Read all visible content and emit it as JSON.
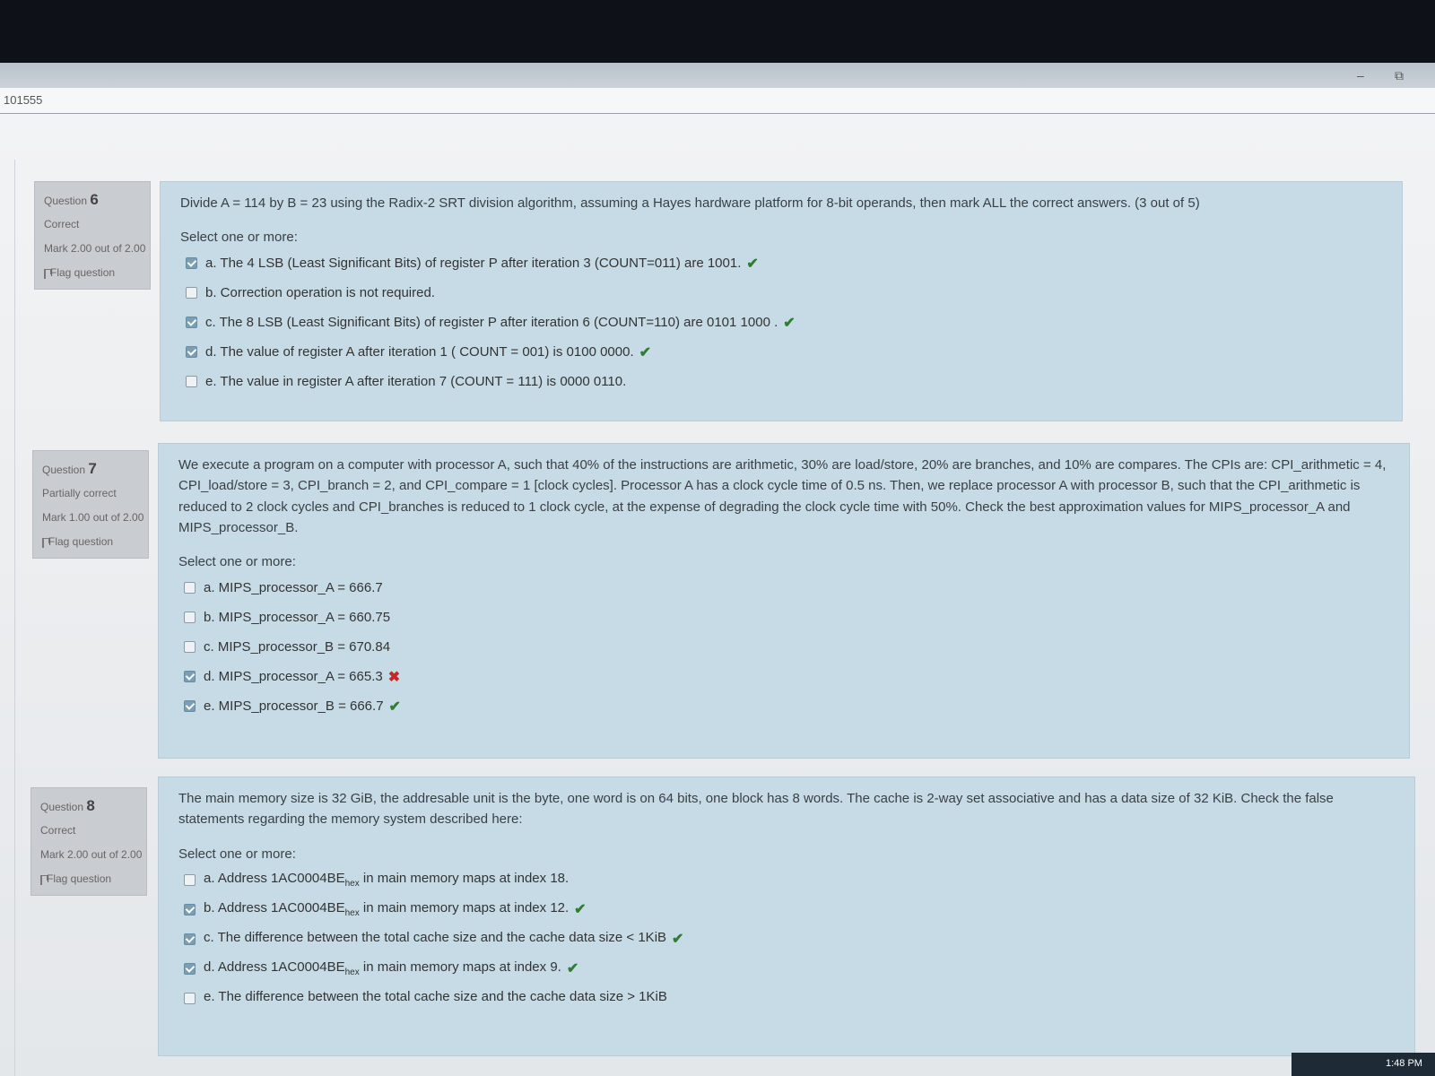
{
  "browser": {
    "address_fragment": "101555",
    "minimize": "–",
    "restore": "⧉"
  },
  "questions": [
    {
      "label": "Question",
      "number": "6",
      "state": "Correct",
      "grade": "Mark 2.00 out of 2.00",
      "flag": "Flag question",
      "text": "Divide A = 114 by B = 23 using the Radix-2 SRT division algorithm, assuming a Hayes hardware platform for 8-bit operands, then mark ALL the correct answers. (3 out of 5)",
      "prompt": "Select one or more:",
      "options": [
        {
          "text": "a. The 4 LSB (Least Significant Bits) of register P after iteration 3 (COUNT=011) are 1001.",
          "checked": true,
          "feedback": "✔"
        },
        {
          "text": "b. Correction operation is not required.",
          "checked": false,
          "feedback": ""
        },
        {
          "text": "c. The 8 LSB (Least Significant Bits) of register P after iteration 6 (COUNT=110) are 0101 1000 .",
          "checked": true,
          "feedback": "✔"
        },
        {
          "text": "d. The value of register A after iteration 1 ( COUNT = 001) is 0100 0000.",
          "checked": true,
          "feedback": "✔"
        },
        {
          "text": "e. The value in register A after iteration 7 (COUNT = 111) is 0000 0110.",
          "checked": false,
          "feedback": ""
        }
      ]
    },
    {
      "label": "Question",
      "number": "7",
      "state": "Partially correct",
      "grade": "Mark 1.00 out of 2.00",
      "flag": "Flag question",
      "text": "We execute a program on a computer with processor A, such that 40% of the instructions are arithmetic, 30% are load/store, 20% are branches, and 10% are compares. The CPIs are: CPI_arithmetic = 4, CPI_load/store = 3, CPI_branch = 2, and CPI_compare = 1 [clock cycles]. Processor A has a clock cycle time of 0.5 ns. Then, we replace processor A with processor B, such that the CPI_arithmetic is reduced to 2 clock cycles and CPI_branches is reduced to 1 clock cycle, at the expense of degrading the clock cycle time with 50%. Check the best approximation values for MIPS_processor_A and MIPS_processor_B.",
      "prompt": "Select one or more:",
      "options": [
        {
          "text": "a. MIPS_processor_A = 666.7",
          "checked": false,
          "feedback": ""
        },
        {
          "text": "b. MIPS_processor_A = 660.75",
          "checked": false,
          "feedback": ""
        },
        {
          "text": "c. MIPS_processor_B = 670.84",
          "checked": false,
          "feedback": ""
        },
        {
          "text": "d. MIPS_processor_A = 665.3",
          "checked": true,
          "feedback": "✖"
        },
        {
          "text": "e. MIPS_processor_B = 666.7",
          "checked": true,
          "feedback": "✔"
        }
      ]
    },
    {
      "label": "Question",
      "number": "8",
      "state": "Correct",
      "grade": "Mark 2.00 out of 2.00",
      "flag": "Flag question",
      "text": "The main memory size is 32 GiB, the addresable unit is the byte, one word is on 64 bits, one block has 8 words. The cache is 2-way set associative and has a data size of 32 KiB. Check the false statements regarding the memory system described here:",
      "prompt": "Select one or more:",
      "options": [
        {
          "pre": "a. Address 1AC0004BE",
          "sub": "hex",
          "post": " in main memory maps at index 18.",
          "checked": false,
          "feedback": ""
        },
        {
          "pre": "b. Address 1AC0004BE",
          "sub": "hex",
          "post": " in main memory maps at index 12.",
          "checked": true,
          "feedback": "✔"
        },
        {
          "pre": "c. The difference between the total cache size and the cache data size < 1KiB",
          "sub": "",
          "post": "",
          "checked": true,
          "feedback": "✔"
        },
        {
          "pre": "d. Address 1AC0004BE",
          "sub": "hex",
          "post": " in main memory maps at index 9.",
          "checked": true,
          "feedback": "✔"
        },
        {
          "pre": "e. The difference between the total cache size and the cache data size > 1KiB",
          "sub": "",
          "post": "",
          "checked": false,
          "feedback": ""
        }
      ]
    }
  ],
  "clock": "1:48 PM",
  "colors": {
    "correct": "#2e7d32",
    "incorrect": "#c62828",
    "panel": "#c7dbe6"
  }
}
